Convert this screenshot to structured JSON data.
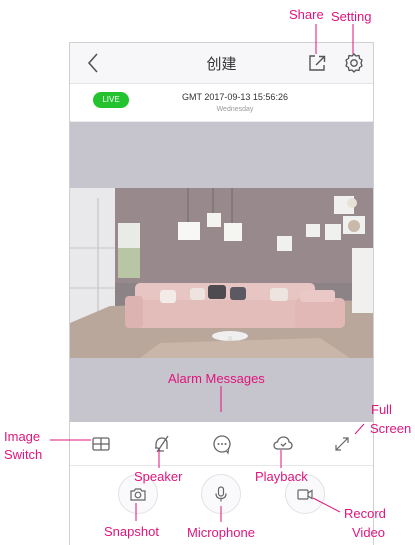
{
  "nav": {
    "title": "创建"
  },
  "info": {
    "live_badge": "LIVE",
    "datetime": "GMT 2017-09-13 15:56:26",
    "weekday": "Wednesday"
  },
  "controls": [
    "image-switch-icon",
    "speaker-muted-icon",
    "alarm-messages-icon",
    "playback-icon",
    "fullscreen-icon"
  ],
  "bottom": [
    "snapshot-camera-icon",
    "microphone-icon",
    "record-video-icon"
  ],
  "annotations": {
    "share": "Share",
    "setting": "Setting",
    "alarm_messages": "Alarm Messages",
    "full_screen_1": "Full",
    "full_screen_2": "Screen",
    "image_switch_1": "Image",
    "image_switch_2": "Switch",
    "speaker": "Speaker",
    "playback": "Playback",
    "snapshot": "Snapshot",
    "microphone": "Microphone",
    "record_video_1": "Record",
    "record_video_2": "Video"
  },
  "colors": {
    "annotation": "#e0157d",
    "live": "#22c32e",
    "video_bg": "#c6c4cc"
  }
}
